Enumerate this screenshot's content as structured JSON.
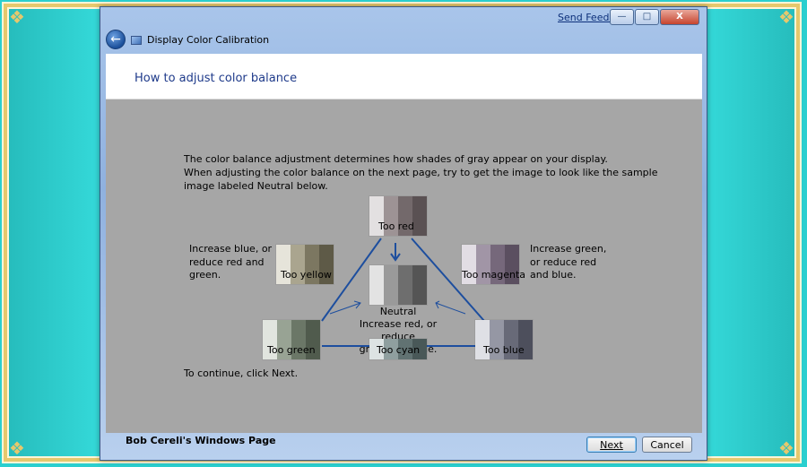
{
  "window": {
    "send_feedback": "Send Feedback",
    "title": "Display Color Calibration",
    "controls": {
      "minimize": "—",
      "maximize": "□",
      "close": "X"
    }
  },
  "page": {
    "heading": "How to adjust color balance",
    "intro": [
      "The color balance adjustment determines how shades of gray appear on your display.",
      "When adjusting the color balance on the next page, try to get the image to look like the sample",
      "image labeled Neutral below."
    ],
    "continue_text": "To continue, click Next."
  },
  "diagram": {
    "left_hint": [
      "Increase blue, or",
      "reduce red and",
      "green."
    ],
    "right_hint": [
      "Increase green,",
      "or reduce red",
      "and blue."
    ],
    "neutral_hint": [
      "Neutral",
      "Increase red, or reduce",
      "green and blue."
    ],
    "swatches": {
      "too_red": {
        "label": "Too red",
        "colors": [
          "#e3e0e1",
          "#9d9395",
          "#73696b",
          "#5a5153"
        ]
      },
      "too_yellow": {
        "label": "Too yellow",
        "colors": [
          "#e6e4da",
          "#aaa58f",
          "#7c7761",
          "#5e5a47"
        ]
      },
      "too_magenta": {
        "label": "Too magenta",
        "colors": [
          "#e2dde4",
          "#a195a6",
          "#76687b",
          "#5b4f60"
        ]
      },
      "neutral": {
        "label": "",
        "colors": [
          "#e3e3e3",
          "#9a9a9a",
          "#6e6e6e",
          "#555555"
        ]
      },
      "too_green": {
        "label": "Too green",
        "colors": [
          "#e1e5df",
          "#98a394",
          "#6b7767",
          "#505b4d"
        ]
      },
      "too_cyan": {
        "label": "Too cyan",
        "colors": [
          "#dde3e3",
          "#8f9f9f",
          "#617272",
          "#495858"
        ]
      },
      "too_blue": {
        "label": "Too blue",
        "colors": [
          "#dfe0e5",
          "#9597a4",
          "#686a78",
          "#4d4f5c"
        ]
      }
    },
    "line_color": "#1d4e9e"
  },
  "footer": {
    "text": "Bob Cereli's Windows Page",
    "next_label": "Next",
    "cancel_label": "Cancel"
  },
  "frame_colors": {
    "background": "#2bcfcf",
    "border": "#e6c86d"
  }
}
